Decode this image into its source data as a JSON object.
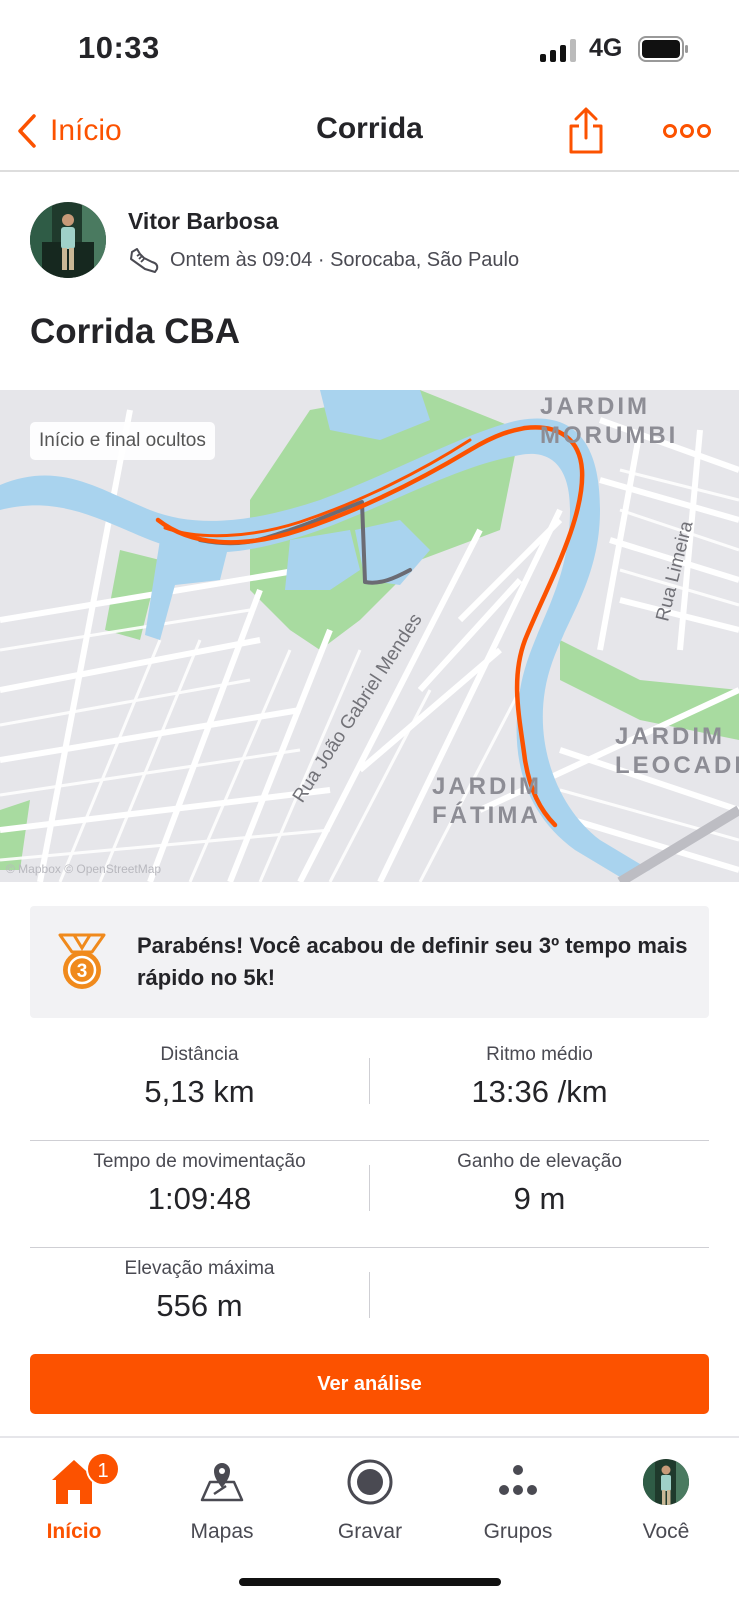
{
  "status_bar": {
    "time": "10:33",
    "network": "4G"
  },
  "header": {
    "back_label": "Início",
    "title": "Corrida"
  },
  "athlete": {
    "name": "Vitor Barbosa",
    "meta": "Ontem às 09:04 · Sorocaba, São Paulo"
  },
  "activity": {
    "title": "Corrida CBA"
  },
  "map": {
    "badge": "Início e final ocultos",
    "places": [
      "JARDIM\nMORUMBI",
      "JARDIM\nLEOCADI",
      "JARDIM\nFÁTIMA"
    ],
    "streets": [
      "Rua Limeira",
      "Rua João Gabriel Mendes"
    ],
    "attribution": "© Mapbox © OpenStreetMap"
  },
  "achievement": {
    "text": "Parabéns! Você acabou de definir seu 3º tempo mais rápido no 5k!",
    "medal_number": "3"
  },
  "stats": [
    {
      "label": "Distância",
      "value": "5,13 km"
    },
    {
      "label": "Ritmo médio",
      "value": "13:36 /km"
    },
    {
      "label": "Tempo de movimentação",
      "value": "1:09:48"
    },
    {
      "label": "Ganho de elevação",
      "value": "9 m"
    },
    {
      "label": "Elevação máxima",
      "value": "556 m"
    }
  ],
  "cta": {
    "label": "Ver análise"
  },
  "tabs": [
    {
      "label": "Início",
      "icon": "home-icon",
      "badge": "1"
    },
    {
      "label": "Mapas",
      "icon": "map-pin-icon"
    },
    {
      "label": "Gravar",
      "icon": "record-icon"
    },
    {
      "label": "Grupos",
      "icon": "groups-icon"
    },
    {
      "label": "Você",
      "icon": "avatar"
    }
  ],
  "colors": {
    "accent": "#fc5200",
    "route": "#fc5200",
    "route_hidden": "#6b6b73",
    "water": "#a9d3ee",
    "park": "#a8dba0"
  }
}
